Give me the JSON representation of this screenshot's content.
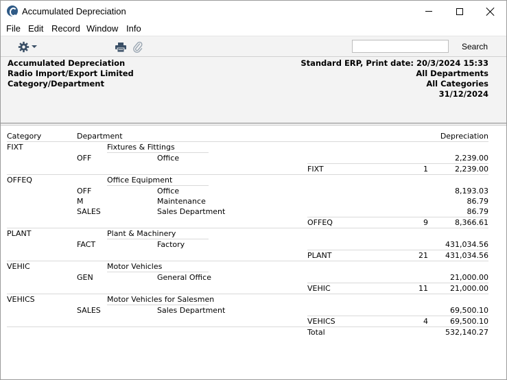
{
  "window": {
    "title": "Accumulated Depreciation"
  },
  "menu": {
    "items": [
      "File",
      "Edit",
      "Record",
      "Window",
      "Info"
    ]
  },
  "toolbar": {
    "search_value": "",
    "search_label": "Search"
  },
  "report_header": {
    "left": [
      "Accumulated Depreciation",
      "Radio Import/Export Limited",
      "Category/Department"
    ],
    "right": [
      "Standard ERP, Print date: 20/3/2024 15:33",
      "All Departments",
      "All Categories",
      "31/12/2024"
    ]
  },
  "columns": {
    "category": "Category",
    "department": "Department",
    "depreciation": "Depreciation"
  },
  "groups": [
    {
      "code": "FIXT",
      "name": "Fixtures & Fittings",
      "rows": [
        {
          "dept": "OFF",
          "dept_name": "Office",
          "amount": "2,239.00"
        }
      ],
      "subtotal": {
        "label": "FIXT",
        "count": "1",
        "amount": "2,239.00"
      }
    },
    {
      "code": "OFFEQ",
      "name": "Office Equipment",
      "rows": [
        {
          "dept": "OFF",
          "dept_name": "Office",
          "amount": "8,193.03"
        },
        {
          "dept": "M",
          "dept_name": "Maintenance",
          "amount": "86.79"
        },
        {
          "dept": "SALES",
          "dept_name": "Sales Department",
          "amount": "86.79"
        }
      ],
      "subtotal": {
        "label": "OFFEQ",
        "count": "9",
        "amount": "8,366.61"
      }
    },
    {
      "code": "PLANT",
      "name": "Plant & Machinery",
      "rows": [
        {
          "dept": "FACT",
          "dept_name": "Factory",
          "amount": "431,034.56"
        }
      ],
      "subtotal": {
        "label": "PLANT",
        "count": "21",
        "amount": "431,034.56"
      }
    },
    {
      "code": "VEHIC",
      "name": "Motor Vehicles",
      "rows": [
        {
          "dept": "GEN",
          "dept_name": "General Office",
          "amount": "21,000.00"
        }
      ],
      "subtotal": {
        "label": "VEHIC",
        "count": "11",
        "amount": "21,000.00"
      }
    },
    {
      "code": "VEHICS",
      "name": "Motor Vehicles for Salesmen",
      "rows": [
        {
          "dept": "SALES",
          "dept_name": "Sales Department",
          "amount": "69,500.10"
        }
      ],
      "subtotal": {
        "label": "VEHICS",
        "count": "4",
        "amount": "69,500.10"
      }
    }
  ],
  "total": {
    "label": "Total",
    "amount": "532,140.27"
  }
}
